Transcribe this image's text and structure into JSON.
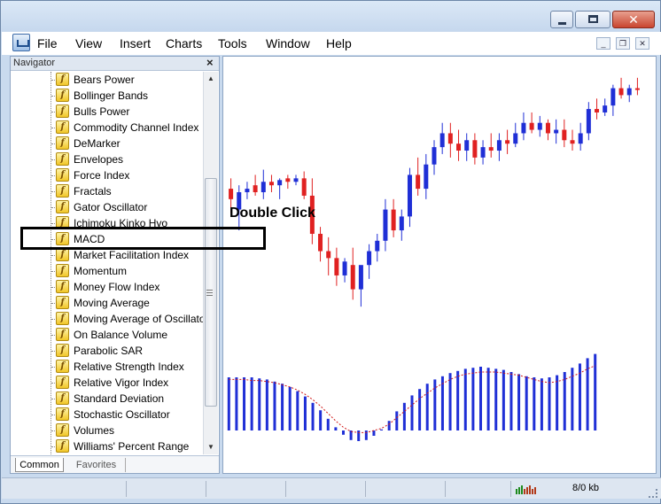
{
  "menu": {
    "items": [
      "File",
      "View",
      "Insert",
      "Charts",
      "Tools",
      "Window",
      "Help"
    ]
  },
  "window_controls": {
    "minimize_icon": "minimize-icon",
    "maximize_icon": "maximize-icon",
    "close_icon": "close-icon"
  },
  "navigator": {
    "title": "Navigator",
    "close_glyph": "×",
    "items": [
      "Bears Power",
      "Bollinger Bands",
      "Bulls Power",
      "Commodity Channel Index",
      "DeMarker",
      "Envelopes",
      "Force Index",
      "Fractals",
      "Gator Oscillator",
      "Ichimoku Kinko Hyo",
      "MACD",
      "Market Facilitation Index",
      "Momentum",
      "Money Flow Index",
      "Moving Average",
      "Moving Average of Oscillator",
      "On Balance Volume",
      "Parabolic SAR",
      "Relative Strength Index",
      "Relative Vigor Index",
      "Standard Deviation",
      "Stochastic Oscillator",
      "Volumes",
      "Williams' Percent Range"
    ],
    "item_icon": "indicator-f-icon",
    "tabs": [
      "Common",
      "Favorites"
    ],
    "active_tab": "Common"
  },
  "annotation": {
    "text": "Double Click",
    "highlighted_item": "MACD"
  },
  "status": {
    "traffic": "8/0 kb"
  },
  "colors": {
    "bull_candle": "#1f2fd6",
    "bear_candle": "#e02121",
    "histogram": "#1f2fd6",
    "signal_line": "#d01818"
  },
  "chart_data": {
    "type": "candlestick+histogram",
    "candles": [
      {
        "o": 68,
        "h": 62,
        "l": 82,
        "c": 74
      },
      {
        "o": 80,
        "h": 66,
        "l": 92,
        "c": 70
      },
      {
        "o": 70,
        "h": 64,
        "l": 74,
        "c": 68
      },
      {
        "o": 66,
        "h": 60,
        "l": 72,
        "c": 70
      },
      {
        "o": 70,
        "h": 57,
        "l": 74,
        "c": 64
      },
      {
        "o": 64,
        "h": 60,
        "l": 70,
        "c": 66
      },
      {
        "o": 66,
        "h": 62,
        "l": 74,
        "c": 63
      },
      {
        "o": 62,
        "h": 60,
        "l": 68,
        "c": 64
      },
      {
        "o": 64,
        "h": 60,
        "l": 66,
        "c": 62
      },
      {
        "o": 62,
        "h": 58,
        "l": 74,
        "c": 72
      },
      {
        "o": 72,
        "h": 62,
        "l": 100,
        "c": 94
      },
      {
        "o": 94,
        "h": 90,
        "l": 110,
        "c": 104
      },
      {
        "o": 104,
        "h": 96,
        "l": 118,
        "c": 108
      },
      {
        "o": 108,
        "h": 102,
        "l": 124,
        "c": 118
      },
      {
        "o": 118,
        "h": 108,
        "l": 122,
        "c": 110
      },
      {
        "o": 112,
        "h": 102,
        "l": 132,
        "c": 126
      },
      {
        "o": 126,
        "h": 118,
        "l": 136,
        "c": 112
      },
      {
        "o": 112,
        "h": 100,
        "l": 120,
        "c": 104
      },
      {
        "o": 104,
        "h": 94,
        "l": 110,
        "c": 98
      },
      {
        "o": 98,
        "h": 74,
        "l": 104,
        "c": 80
      },
      {
        "o": 80,
        "h": 74,
        "l": 96,
        "c": 92
      },
      {
        "o": 92,
        "h": 80,
        "l": 98,
        "c": 84
      },
      {
        "o": 84,
        "h": 56,
        "l": 90,
        "c": 60
      },
      {
        "o": 60,
        "h": 50,
        "l": 72,
        "c": 68
      },
      {
        "o": 68,
        "h": 48,
        "l": 74,
        "c": 54
      },
      {
        "o": 54,
        "h": 40,
        "l": 60,
        "c": 44
      },
      {
        "o": 44,
        "h": 30,
        "l": 48,
        "c": 36
      },
      {
        "o": 36,
        "h": 30,
        "l": 50,
        "c": 42
      },
      {
        "o": 42,
        "h": 34,
        "l": 52,
        "c": 46
      },
      {
        "o": 46,
        "h": 36,
        "l": 52,
        "c": 40
      },
      {
        "o": 40,
        "h": 36,
        "l": 54,
        "c": 50
      },
      {
        "o": 50,
        "h": 40,
        "l": 54,
        "c": 44
      },
      {
        "o": 44,
        "h": 36,
        "l": 50,
        "c": 46
      },
      {
        "o": 46,
        "h": 36,
        "l": 52,
        "c": 40
      },
      {
        "o": 40,
        "h": 34,
        "l": 48,
        "c": 42
      },
      {
        "o": 42,
        "h": 30,
        "l": 44,
        "c": 36
      },
      {
        "o": 36,
        "h": 24,
        "l": 40,
        "c": 30
      },
      {
        "o": 30,
        "h": 24,
        "l": 36,
        "c": 34
      },
      {
        "o": 34,
        "h": 26,
        "l": 38,
        "c": 30
      },
      {
        "o": 30,
        "h": 28,
        "l": 40,
        "c": 36
      },
      {
        "o": 36,
        "h": 28,
        "l": 42,
        "c": 34
      },
      {
        "o": 34,
        "h": 28,
        "l": 44,
        "c": 40
      },
      {
        "o": 40,
        "h": 34,
        "l": 46,
        "c": 42
      },
      {
        "o": 42,
        "h": 30,
        "l": 46,
        "c": 36
      },
      {
        "o": 36,
        "h": 18,
        "l": 40,
        "c": 22
      },
      {
        "o": 22,
        "h": 16,
        "l": 28,
        "c": 24
      },
      {
        "o": 24,
        "h": 16,
        "l": 26,
        "c": 20
      },
      {
        "o": 20,
        "h": 8,
        "l": 26,
        "c": 10
      },
      {
        "o": 10,
        "h": 4,
        "l": 16,
        "c": 14
      },
      {
        "o": 14,
        "h": 8,
        "l": 18,
        "c": 10
      },
      {
        "o": 10,
        "h": 4,
        "l": 14,
        "c": 10
      }
    ],
    "histogram": [
      5.0,
      5.0,
      5.0,
      5.0,
      4.9,
      4.8,
      4.6,
      4.4,
      4.1,
      3.7,
      3.2,
      2.6,
      1.9,
      1.1,
      0.3,
      -0.4,
      -0.9,
      -1.0,
      -0.9,
      -0.5,
      0.1,
      0.9,
      1.8,
      2.6,
      3.3,
      3.9,
      4.4,
      4.8,
      5.1,
      5.4,
      5.6,
      5.8,
      5.9,
      6.0,
      5.9,
      5.8,
      5.7,
      5.5,
      5.3,
      5.1,
      5.0,
      4.9,
      5.0,
      5.2,
      5.5,
      5.9,
      6.3,
      6.8,
      7.2
    ],
    "signal": [
      4.8,
      4.8,
      4.8,
      4.7,
      4.7,
      4.6,
      4.5,
      4.3,
      4.1,
      3.8,
      3.4,
      2.9,
      2.3,
      1.6,
      0.9,
      0.3,
      -0.1,
      -0.2,
      -0.2,
      0.0,
      0.2,
      0.6,
      1.2,
      1.8,
      2.4,
      3.0,
      3.5,
      4.0,
      4.4,
      4.8,
      5.1,
      5.3,
      5.4,
      5.5,
      5.5,
      5.5,
      5.4,
      5.3,
      5.2,
      5.0,
      4.8,
      4.6,
      4.5,
      4.6,
      4.8,
      5.1,
      5.4,
      5.8,
      6.1
    ]
  }
}
